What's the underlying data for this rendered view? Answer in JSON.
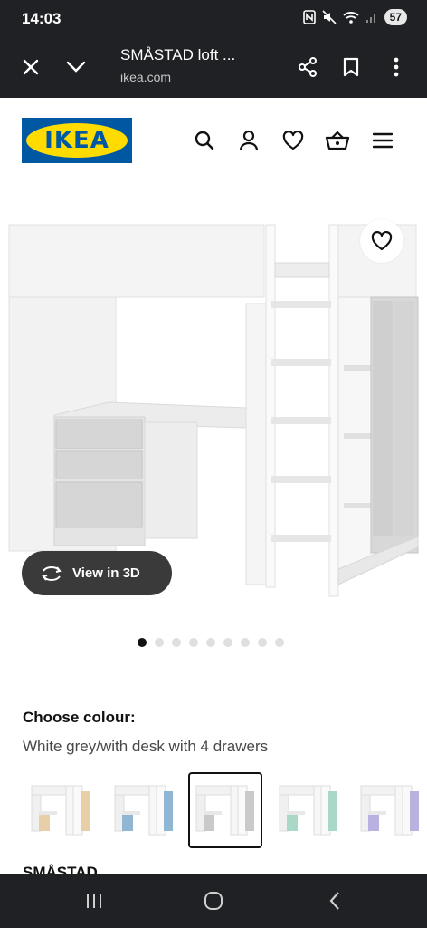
{
  "status_bar": {
    "time": "14:03",
    "battery": "57"
  },
  "browser": {
    "page_title": "SMÅSTAD loft ...",
    "url": "ikea.com"
  },
  "brand": {
    "logo_text": "IKEA",
    "colors": {
      "blue": "#0058a3",
      "yellow": "#ffdb00"
    }
  },
  "product": {
    "view_3d_label": "View in 3D",
    "carousel": {
      "total": 9,
      "active_index": 0
    }
  },
  "colour": {
    "label": "Choose colour:",
    "selected": "White grey/with desk with 4 drawers",
    "options": [
      {
        "icon": "loft-bed-beige-thumbnail",
        "accent": "#e8cfa8"
      },
      {
        "icon": "loft-bed-blue-thumbnail",
        "accent": "#8fb7d3"
      },
      {
        "icon": "loft-bed-grey-thumbnail",
        "accent": "#c9c9c9",
        "selected": true
      },
      {
        "icon": "loft-bed-mint-thumbnail",
        "accent": "#a9d8c6"
      },
      {
        "icon": "loft-bed-lilac-thumbnail",
        "accent": "#b9b1e0"
      }
    ]
  },
  "next_section": {
    "heading": "SMÅSTAD"
  }
}
